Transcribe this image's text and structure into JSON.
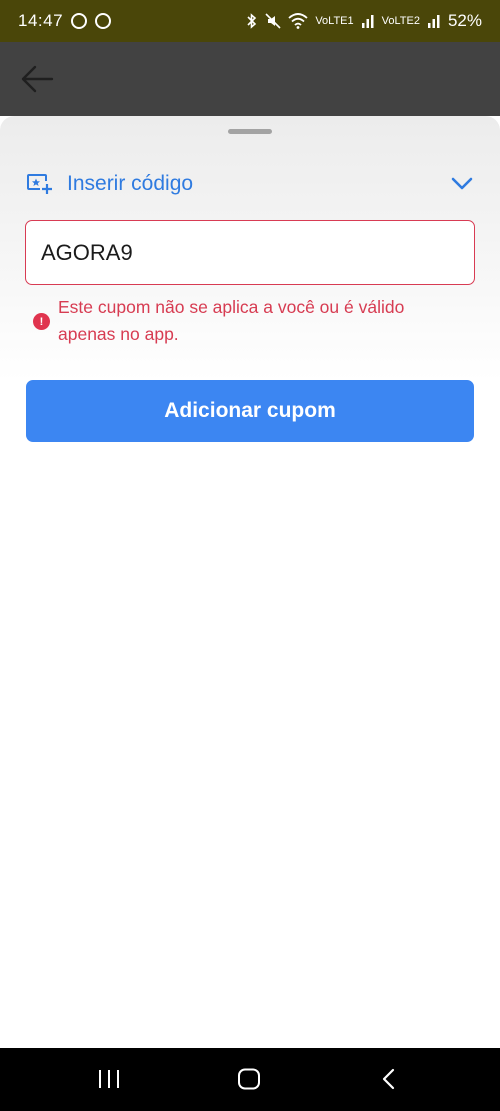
{
  "status_bar": {
    "time": "14:47",
    "network_1": "VoLTE1",
    "network_2": "VoLTE2",
    "battery": "52%",
    "icons": [
      "whatsapp-icon",
      "b-icon",
      "bluetooth-icon",
      "mute-icon",
      "wifi-icon",
      "signal-icon",
      "signal-icon"
    ]
  },
  "header": {
    "back_icon": "arrow-left-icon"
  },
  "sheet": {
    "section_title": "Inserir código",
    "section_icon": "coupon-plus-icon",
    "chevron_icon": "chevron-down-icon",
    "coupon_input_value": "AGORA9",
    "error_message": "Este cupom não se aplica a você ou é válido apenas no app.",
    "error_icon": "exclamation-icon",
    "error_icon_glyph": "!",
    "add_button_label": "Adicionar cupom"
  },
  "colors": {
    "accent_blue": "#3c86f2",
    "title_blue": "#2f7be0",
    "error_red": "#d73c52",
    "status_bar_bg": "#4a4609"
  },
  "nav_bar": {
    "recents_icon": "recents-icon",
    "home_icon": "home-icon",
    "back_icon": "back-chevron-icon"
  }
}
